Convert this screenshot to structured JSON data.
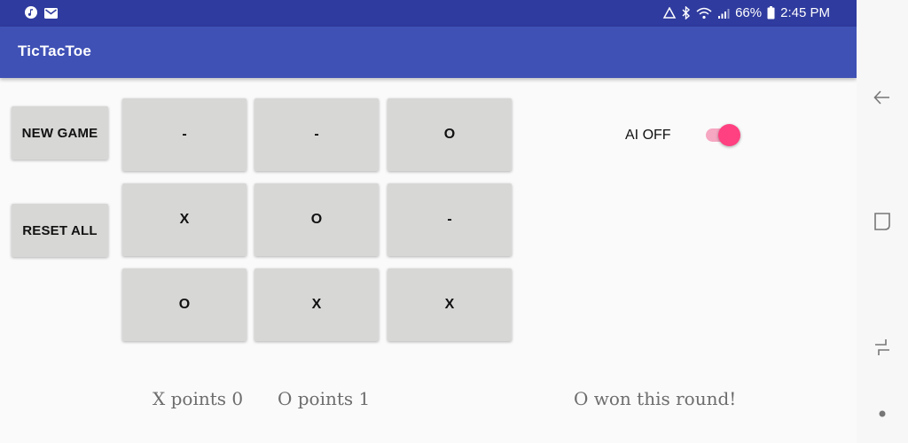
{
  "status_bar": {
    "battery": "66%",
    "time": "2:45 PM"
  },
  "app_bar": {
    "title": "TicTacToe"
  },
  "buttons": {
    "new_game": "NEW GAME",
    "reset_all": "RESET ALL"
  },
  "board": {
    "cells": [
      "-",
      "-",
      "O",
      "X",
      "O",
      "-",
      "O",
      "X",
      "X"
    ]
  },
  "ai_toggle": {
    "label": "AI OFF",
    "checked": true,
    "track_color": "#f6a7c2",
    "thumb_color": "#ff4081"
  },
  "scores": {
    "x_points": "X points 0",
    "o_points": "O points 1",
    "result": "O won this round!"
  },
  "colors": {
    "primary": "#3f51b5",
    "primary_dark": "#2f3b9e",
    "button_bg": "#d7d8d6"
  }
}
